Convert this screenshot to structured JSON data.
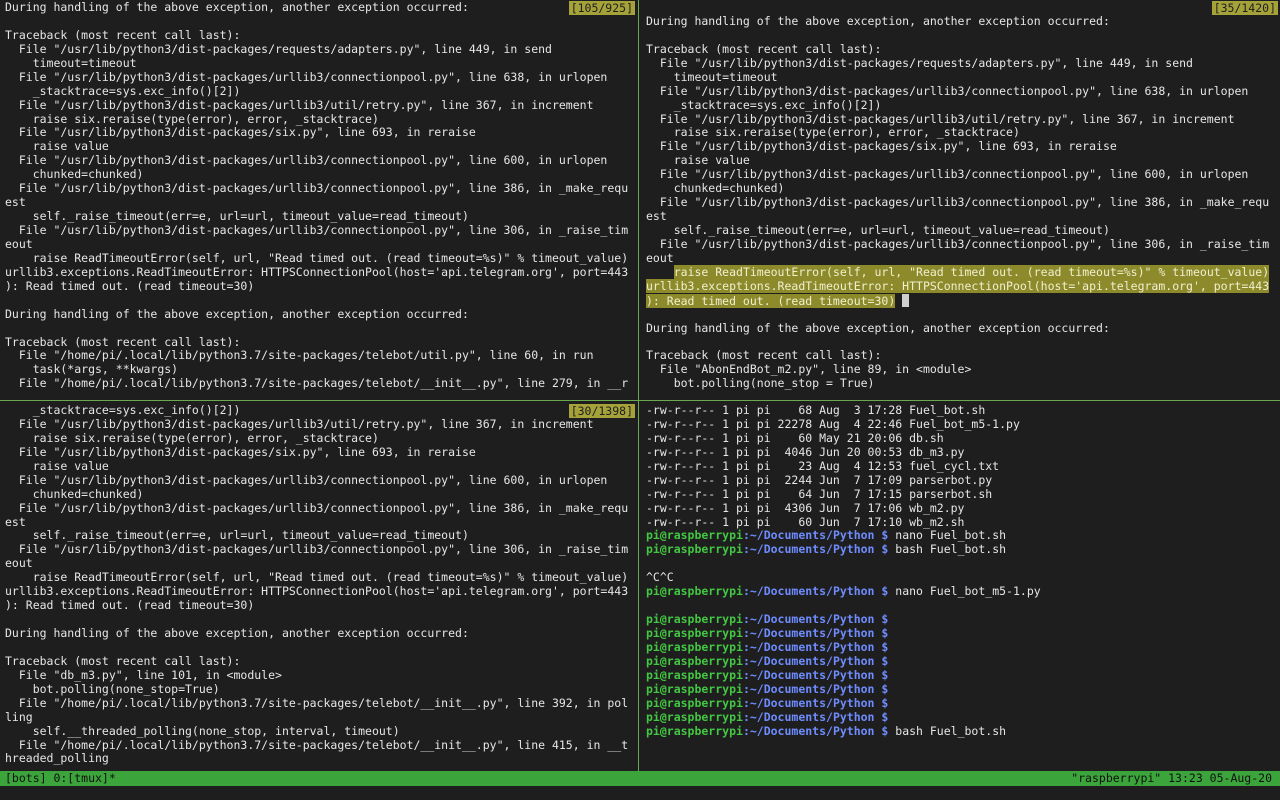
{
  "panes": {
    "top_left": {
      "position": "[105/925]",
      "lines": [
        "During handling of the above exception, another exception occurred:",
        "",
        "Traceback (most recent call last):",
        "  File \"/usr/lib/python3/dist-packages/requests/adapters.py\", line 449, in send",
        "    timeout=timeout",
        "  File \"/usr/lib/python3/dist-packages/urllib3/connectionpool.py\", line 638, in urlopen",
        "    _stacktrace=sys.exc_info()[2])",
        "  File \"/usr/lib/python3/dist-packages/urllib3/util/retry.py\", line 367, in increment",
        "    raise six.reraise(type(error), error, _stacktrace)",
        "  File \"/usr/lib/python3/dist-packages/six.py\", line 693, in reraise",
        "    raise value",
        "  File \"/usr/lib/python3/dist-packages/urllib3/connectionpool.py\", line 600, in urlopen",
        "    chunked=chunked)",
        "  File \"/usr/lib/python3/dist-packages/urllib3/connectionpool.py\", line 386, in _make_requ",
        "est",
        "    self._raise_timeout(err=e, url=url, timeout_value=read_timeout)",
        "  File \"/usr/lib/python3/dist-packages/urllib3/connectionpool.py\", line 306, in _raise_tim",
        "eout",
        "    raise ReadTimeoutError(self, url, \"Read timed out. (read timeout=%s)\" % timeout_value)",
        "urllib3.exceptions.ReadTimeoutError: HTTPSConnectionPool(host='api.telegram.org', port=443",
        "): Read timed out. (read timeout=30)",
        "",
        "During handling of the above exception, another exception occurred:",
        "",
        "Traceback (most recent call last):",
        "  File \"/home/pi/.local/lib/python3.7/site-packages/telebot/util.py\", line 60, in run",
        "    task(*args, **kwargs)",
        "  File \"/home/pi/.local/lib/python3.7/site-packages/telebot/__init__.py\", line 279, in __r"
      ]
    },
    "top_right": {
      "position": "[35/1420]",
      "lines_before": [
        "",
        "During handling of the above exception, another exception occurred:",
        "",
        "Traceback (most recent call last):",
        "  File \"/usr/lib/python3/dist-packages/requests/adapters.py\", line 449, in send",
        "    timeout=timeout",
        "  File \"/usr/lib/python3/dist-packages/urllib3/connectionpool.py\", line 638, in urlopen",
        "    _stacktrace=sys.exc_info()[2])",
        "  File \"/usr/lib/python3/dist-packages/urllib3/util/retry.py\", line 367, in increment",
        "    raise six.reraise(type(error), error, _stacktrace)",
        "  File \"/usr/lib/python3/dist-packages/six.py\", line 693, in reraise",
        "    raise value",
        "  File \"/usr/lib/python3/dist-packages/urllib3/connectionpool.py\", line 600, in urlopen",
        "    chunked=chunked)",
        "  File \"/usr/lib/python3/dist-packages/urllib3/connectionpool.py\", line 386, in _make_requ",
        "est",
        "    self._raise_timeout(err=e, url=url, timeout_value=read_timeout)",
        "  File \"/usr/lib/python3/dist-packages/urllib3/connectionpool.py\", line 306, in _raise_tim",
        "eout"
      ],
      "highlighted": {
        "indent": "    ",
        "line1": "raise ReadTimeoutError(self, url, \"Read timed out. (read timeout=%s)\" % timeout_value)",
        "line2": "urllib3.exceptions.ReadTimeoutError: HTTPSConnectionPool(host='api.telegram.org', port=443",
        "line3": "): Read timed out. (read timeout=30)"
      },
      "lines_after": [
        "",
        "During handling of the above exception, another exception occurred:",
        "",
        "Traceback (most recent call last):",
        "  File \"AbonEndBot_m2.py\", line 89, in <module>",
        "    bot.polling(none_stop = True)"
      ]
    },
    "bottom_left": {
      "position": "[30/1398]",
      "lines": [
        "    _stacktrace=sys.exc_info()[2])",
        "  File \"/usr/lib/python3/dist-packages/urllib3/util/retry.py\", line 367, in increment",
        "    raise six.reraise(type(error), error, _stacktrace)",
        "  File \"/usr/lib/python3/dist-packages/six.py\", line 693, in reraise",
        "    raise value",
        "  File \"/usr/lib/python3/dist-packages/urllib3/connectionpool.py\", line 600, in urlopen",
        "    chunked=chunked)",
        "  File \"/usr/lib/python3/dist-packages/urllib3/connectionpool.py\", line 386, in _make_requ",
        "est",
        "    self._raise_timeout(err=e, url=url, timeout_value=read_timeout)",
        "  File \"/usr/lib/python3/dist-packages/urllib3/connectionpool.py\", line 306, in _raise_tim",
        "eout",
        "    raise ReadTimeoutError(self, url, \"Read timed out. (read timeout=%s)\" % timeout_value)",
        "urllib3.exceptions.ReadTimeoutError: HTTPSConnectionPool(host='api.telegram.org', port=443",
        "): Read timed out. (read timeout=30)",
        "",
        "During handling of the above exception, another exception occurred:",
        "",
        "Traceback (most recent call last):",
        "  File \"db_m3.py\", line 101, in <module>",
        "    bot.polling(none_stop=True)",
        "  File \"/home/pi/.local/lib/python3.7/site-packages/telebot/__init__.py\", line 392, in pol",
        "ling",
        "    self.__threaded_polling(none_stop, interval, timeout)",
        "  File \"/home/pi/.local/lib/python3.7/site-packages/telebot/__init__.py\", line 415, in __t",
        "hreaded_polling"
      ]
    },
    "bottom_right": {
      "user_host": "pi@raspberrypi",
      "path": ":~/Documents/Python $",
      "lines": [
        {
          "text": "-rw-r--r-- 1 pi pi    68 Aug  3 17:28 Fuel_bot.sh"
        },
        {
          "text": "-rw-r--r-- 1 pi pi 22278 Aug  4 22:46 Fuel_bot_m5-1.py"
        },
        {
          "text": "-rw-r--r-- 1 pi pi    60 May 21 20:06 db.sh"
        },
        {
          "text": "-rw-r--r-- 1 pi pi  4046 Jun 20 00:53 db_m3.py"
        },
        {
          "text": "-rw-r--r-- 1 pi pi    23 Aug  4 12:53 fuel_cycl.txt"
        },
        {
          "text": "-rw-r--r-- 1 pi pi  2244 Jun  7 17:09 parserbot.py"
        },
        {
          "text": "-rw-r--r-- 1 pi pi    64 Jun  7 17:15 parserbot.sh"
        },
        {
          "text": "-rw-r--r-- 1 pi pi  4306 Jun  7 17:06 wb_m2.py"
        },
        {
          "text": "-rw-r--r-- 1 pi pi    60 Jun  7 17:10 wb_m2.sh"
        },
        {
          "prompt": true,
          "cmd": " nano Fuel_bot.sh"
        },
        {
          "prompt": true,
          "cmd": " bash Fuel_bot.sh"
        },
        {
          "text": ""
        },
        {
          "text": "^C^C"
        },
        {
          "prompt": true,
          "cmd": " nano Fuel_bot_m5-1.py"
        },
        {
          "text": ""
        },
        {
          "prompt": true,
          "cmd": ""
        },
        {
          "prompt": true,
          "cmd": ""
        },
        {
          "prompt": true,
          "cmd": ""
        },
        {
          "prompt": true,
          "cmd": ""
        },
        {
          "prompt": true,
          "cmd": ""
        },
        {
          "prompt": true,
          "cmd": ""
        },
        {
          "prompt": true,
          "cmd": ""
        },
        {
          "prompt": true,
          "cmd": ""
        },
        {
          "prompt": true,
          "cmd": " bash Fuel_bot.sh"
        }
      ]
    }
  },
  "status_bar": {
    "left": "[bots] 0:[tmux]*",
    "right": "\"raspberrypi\" 13:23 05-Aug-20"
  },
  "colors": {
    "background": "#1e1e1e",
    "status_bar": "#3ba53b",
    "pane_border": "#6aa84f",
    "position_badge": "#a6a23a",
    "prompt_user": "#43c743",
    "prompt_path": "#6f8cff"
  }
}
